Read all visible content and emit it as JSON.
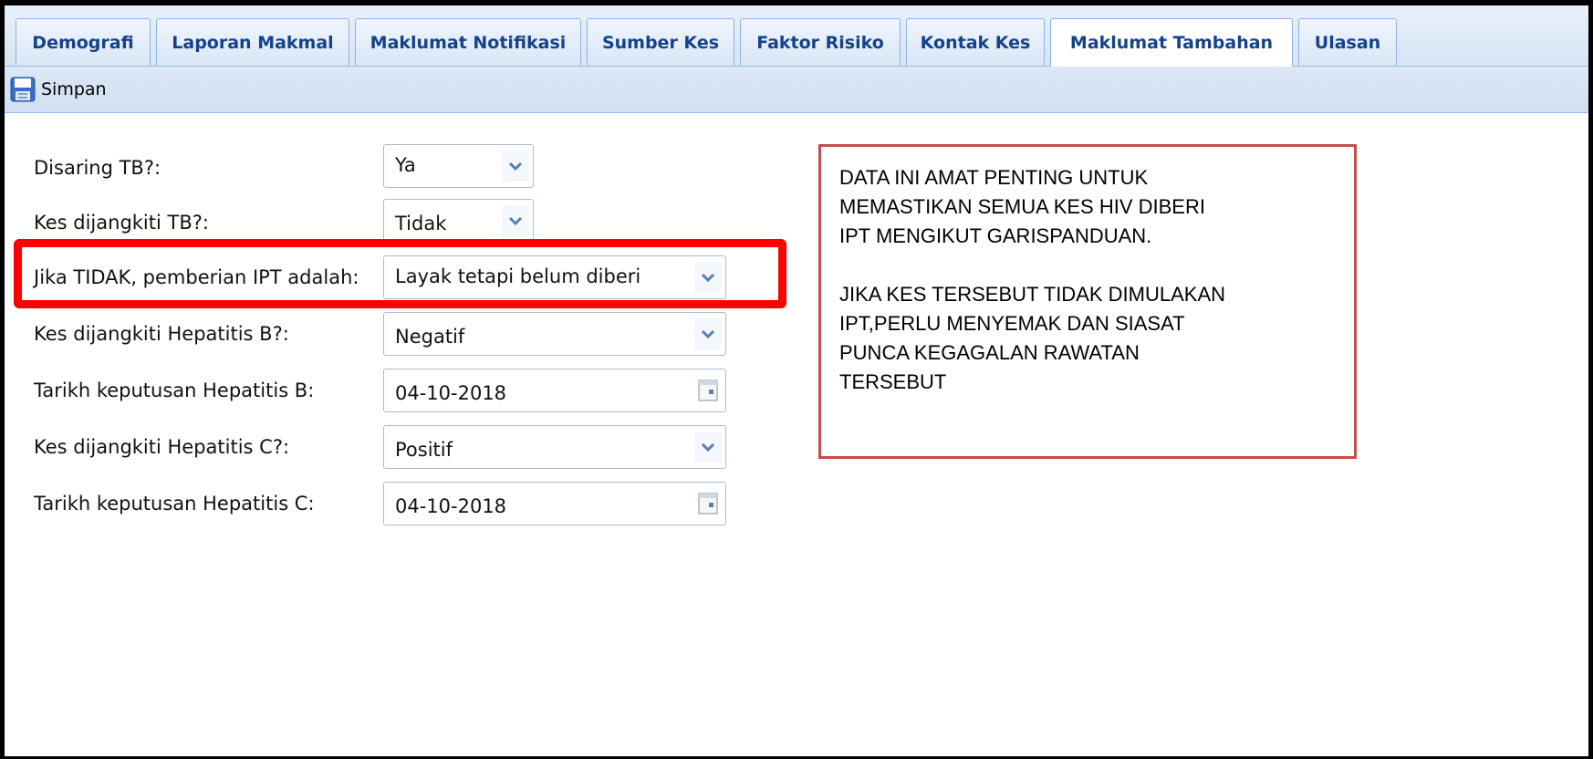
{
  "tabs": [
    {
      "label": "Demografi"
    },
    {
      "label": "Laporan Makmal"
    },
    {
      "label": "Maklumat Notifikasi"
    },
    {
      "label": "Sumber Kes"
    },
    {
      "label": "Faktor Risiko"
    },
    {
      "label": "Kontak Kes"
    },
    {
      "label": "Maklumat Tambahan",
      "active": true
    },
    {
      "label": "Ulasan"
    }
  ],
  "toolbar": {
    "save_label": "Simpan",
    "save_icon": "floppy-disk-icon"
  },
  "form": {
    "tb_screened": {
      "label": "Disaring TB?:",
      "value": "Ya"
    },
    "tb_infected": {
      "label": "Kes dijangkiti TB?:",
      "value": "Tidak"
    },
    "ipt": {
      "label": "Jika TIDAK, pemberian IPT adalah:",
      "value": "Layak tetapi belum diberi"
    },
    "hep_b": {
      "label": "Kes dijangkiti Hepatitis B?:",
      "value": "Negatif"
    },
    "hep_b_date": {
      "label": "Tarikh keputusan Hepatitis B:",
      "value": "04-10-2018"
    },
    "hep_c": {
      "label": "Kes dijangkiti Hepatitis C?:",
      "value": "Positif"
    },
    "hep_c_date": {
      "label": "Tarikh keputusan Hepatitis C:",
      "value": "04-10-2018"
    }
  },
  "annotation": {
    "para1_line1": "DATA INI AMAT PENTING UNTUK",
    "para1_line2": "MEMASTIKAN SEMUA KES HIV DIBERI",
    "para1_line3": "IPT MENGIKUT GARISPANDUAN.",
    "para2_line1": "JIKA KES TERSEBUT TIDAK DIMULAKAN",
    "para2_line2": "IPT,PERLU MENYEMAK DAN SIASAT",
    "para2_line3": "PUNCA KEGAGALAN RAWATAN",
    "para2_line4": "TERSEBUT"
  },
  "colors": {
    "highlight": "#ff0000",
    "annotation_border": "#c0504d",
    "tab_text": "#15428b"
  }
}
